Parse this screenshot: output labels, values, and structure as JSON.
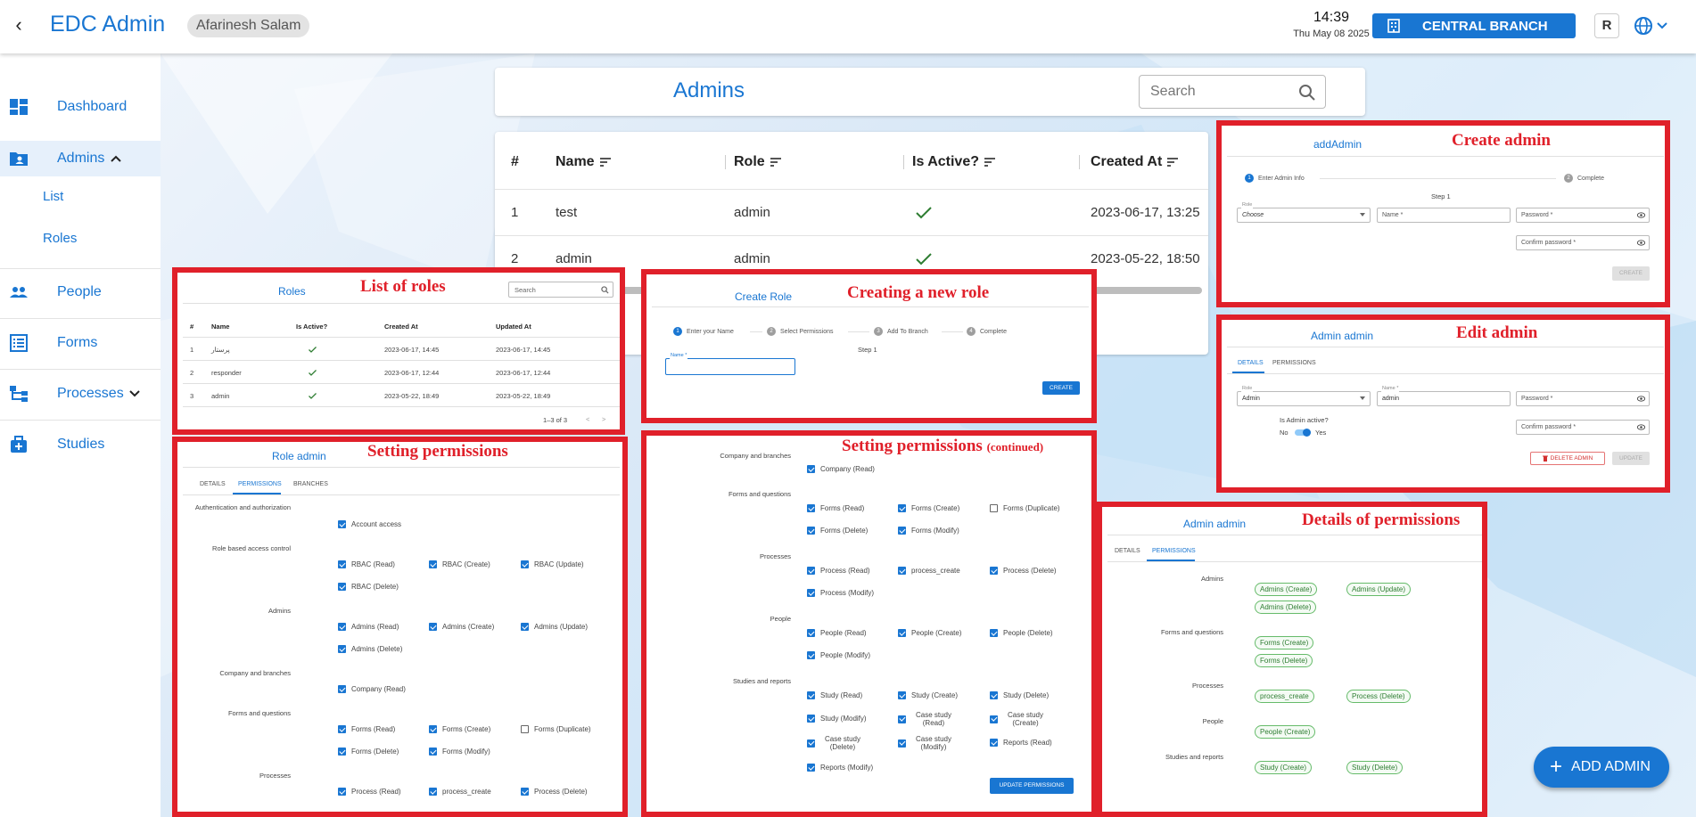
{
  "header": {
    "app_title": "EDC Admin",
    "user_name": "Afarinesh Salam",
    "time": "14:39",
    "date": "Thu May 08 2025",
    "branch": "CENTRAL BRANCH",
    "user_initial": "R"
  },
  "sidebar": {
    "dashboard": "Dashboard",
    "admins": "Admins",
    "list": "List",
    "roles": "Roles",
    "people": "People",
    "forms": "Forms",
    "processes": "Processes",
    "studies": "Studies"
  },
  "admins_page": {
    "title": "Admins",
    "search_placeholder": "Search",
    "columns": [
      "#",
      "Name",
      "Role",
      "Is Active?",
      "Created At"
    ],
    "rows": [
      {
        "num": "1",
        "name": "test",
        "role": "admin",
        "created": "2023-06-17, 13:25"
      },
      {
        "num": "2",
        "name": "admin",
        "role": "admin",
        "created": "2023-05-22, 18:50"
      }
    ],
    "add_button": "ADD ADMIN"
  },
  "captions": {
    "roles_list": "List of roles",
    "create_role": "Creating a new role",
    "create_admin": "Create admin",
    "edit_admin": "Edit admin",
    "set_perms": "Setting permissions",
    "set_perms_cont": "Setting permissions",
    "continued": "(continued)",
    "perm_details": "Details of permissions"
  },
  "roles_panel": {
    "title": "Roles",
    "search": "Search",
    "columns": [
      "#",
      "Name",
      "Is Active?",
      "Created At",
      "Updated At"
    ],
    "rows": [
      {
        "num": "1",
        "name": "پرستار",
        "created": "2023-06-17, 14:45",
        "updated": "2023-06-17, 14:45"
      },
      {
        "num": "2",
        "name": "responder",
        "created": "2023-06-17, 12:44",
        "updated": "2023-06-17, 12:44"
      },
      {
        "num": "3",
        "name": "admin",
        "created": "2023-05-22, 18:49",
        "updated": "2023-05-22, 18:49"
      }
    ],
    "pagination": "1–3 of 3"
  },
  "create_role_panel": {
    "title": "Create Role",
    "steps": [
      "Enter your Name",
      "Select Permissions",
      "Add To Branch",
      "Complete"
    ],
    "step_label": "Step 1",
    "name_label": "Name *",
    "create_button": "CREATE"
  },
  "add_admin_panel": {
    "title": "addAdmin",
    "steps": [
      "Enter Admin Info",
      "Complete"
    ],
    "step_label": "Step 1",
    "role_label": "Role",
    "role_value": "Choose",
    "name_field": "Name *",
    "password_field": "Password *",
    "confirm_field": "Confirm password *",
    "create_button": "CREATE"
  },
  "edit_admin_panel": {
    "title": "Admin admin",
    "tabs": [
      "DETAILS",
      "PERMISSIONS"
    ],
    "role_label": "Role",
    "role_value": "Admin",
    "name_label": "Name *",
    "name_value": "admin",
    "password_field": "Password *",
    "confirm_field": "Confirm password *",
    "active_question": "Is Admin active?",
    "no": "No",
    "yes": "Yes",
    "delete_button": "DELETE ADMIN",
    "update_button": "UPDATE"
  },
  "role_admin_panel": {
    "title": "Role admin",
    "tabs": [
      "DETAILS",
      "PERMISSIONS",
      "BRANCHES"
    ],
    "groups": {
      "auth": "Authentication and authorization",
      "rbac": "Role based access control",
      "admins": "Admins",
      "company": "Company and branches",
      "forms": "Forms and questions",
      "processes": "Processes"
    },
    "perms": {
      "account_access": "Account access",
      "rbac_read": "RBAC (Read)",
      "rbac_create": "RBAC (Create)",
      "rbac_update": "RBAC (Update)",
      "rbac_delete": "RBAC (Delete)",
      "admins_read": "Admins (Read)",
      "admins_create": "Admins (Create)",
      "admins_update": "Admins (Update)",
      "admins_delete": "Admins (Delete)",
      "company_read": "Company (Read)",
      "forms_read": "Forms (Read)",
      "forms_create": "Forms (Create)",
      "forms_duplicate": "Forms (Duplicate)",
      "forms_delete": "Forms (Delete)",
      "forms_modify": "Forms (Modify)",
      "process_read": "Process (Read)",
      "process_create": "process_create",
      "process_delete": "Process (Delete)"
    }
  },
  "perm_cont_panel": {
    "groups": {
      "company": "Company and branches",
      "forms": "Forms and questions",
      "processes": "Processes",
      "people": "People",
      "studies": "Studies and reports"
    },
    "perms": {
      "company_read": "Company (Read)",
      "forms_read": "Forms (Read)",
      "forms_create": "Forms (Create)",
      "forms_duplicate": "Forms (Duplicate)",
      "forms_delete": "Forms (Delete)",
      "forms_modify": "Forms (Modify)",
      "process_read": "Process (Read)",
      "process_create": "process_create",
      "process_delete": "Process (Delete)",
      "process_modify": "Process (Modify)",
      "people_read": "People (Read)",
      "people_create": "People (Create)",
      "people_delete": "People (Delete)",
      "people_modify": "People (Modify)",
      "study_read": "Study (Read)",
      "study_create": "Study (Create)",
      "study_delete": "Study (Delete)",
      "study_modify": "Study (Modify)",
      "case_read": "Case study (Read)",
      "case_create": "Case study (Create)",
      "case_delete": "Case study (Delete)",
      "case_modify": "Case study (Modify)",
      "reports_read": "Reports (Read)",
      "reports_modify": "Reports (Modify)"
    },
    "update_button": "UPDATE PERMISSIONS"
  },
  "perm_details_panel": {
    "title": "Admin admin",
    "tabs": [
      "DETAILS",
      "PERMISSIONS"
    ],
    "groups": {
      "admins": "Admins",
      "forms": "Forms and questions",
      "processes": "Processes",
      "people": "People",
      "studies": "Studies and reports"
    },
    "chips": {
      "admins_create": "Admins (Create)",
      "admins_update": "Admins (Update)",
      "admins_delete": "Admins (Delete)",
      "forms_create": "Forms (Create)",
      "forms_delete": "Forms (Delete)",
      "process_create": "process_create",
      "process_delete": "Process (Delete)",
      "people_create": "People (Create)",
      "study_create": "Study (Create)",
      "study_delete": "Study (Delete)"
    }
  }
}
